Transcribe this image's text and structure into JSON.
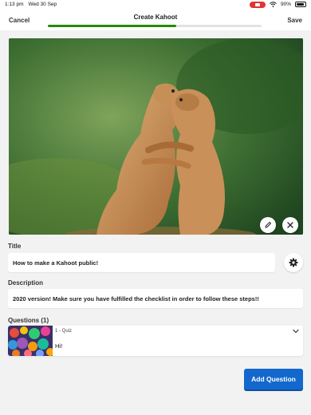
{
  "status_bar": {
    "time": "1:13 pm",
    "date": "Wed 30 Sep",
    "battery": "90%",
    "battery_level": 0.9
  },
  "header": {
    "cancel_label": "Cancel",
    "title": "Create Kahoot",
    "save_label": "Save",
    "progress": 0.6,
    "progress_color": "#26890c"
  },
  "cover": {
    "edit_icon": "pencil-icon",
    "remove_icon": "close-icon"
  },
  "form": {
    "title_label": "Title",
    "title_value": "How to make a Kahoot public!",
    "description_label": "Description",
    "description_value": "2020 version! Make sure you have fulfilled the checklist in order to follow these steps!!",
    "settings_icon": "gear-icon"
  },
  "questions": {
    "label": "Questions (1)",
    "items": [
      {
        "type": "1 - Quiz",
        "text": "Hi!"
      }
    ]
  },
  "add_question_label": "Add Question",
  "colors": {
    "accent": "#1368ce",
    "background": "#f2f2f2"
  }
}
